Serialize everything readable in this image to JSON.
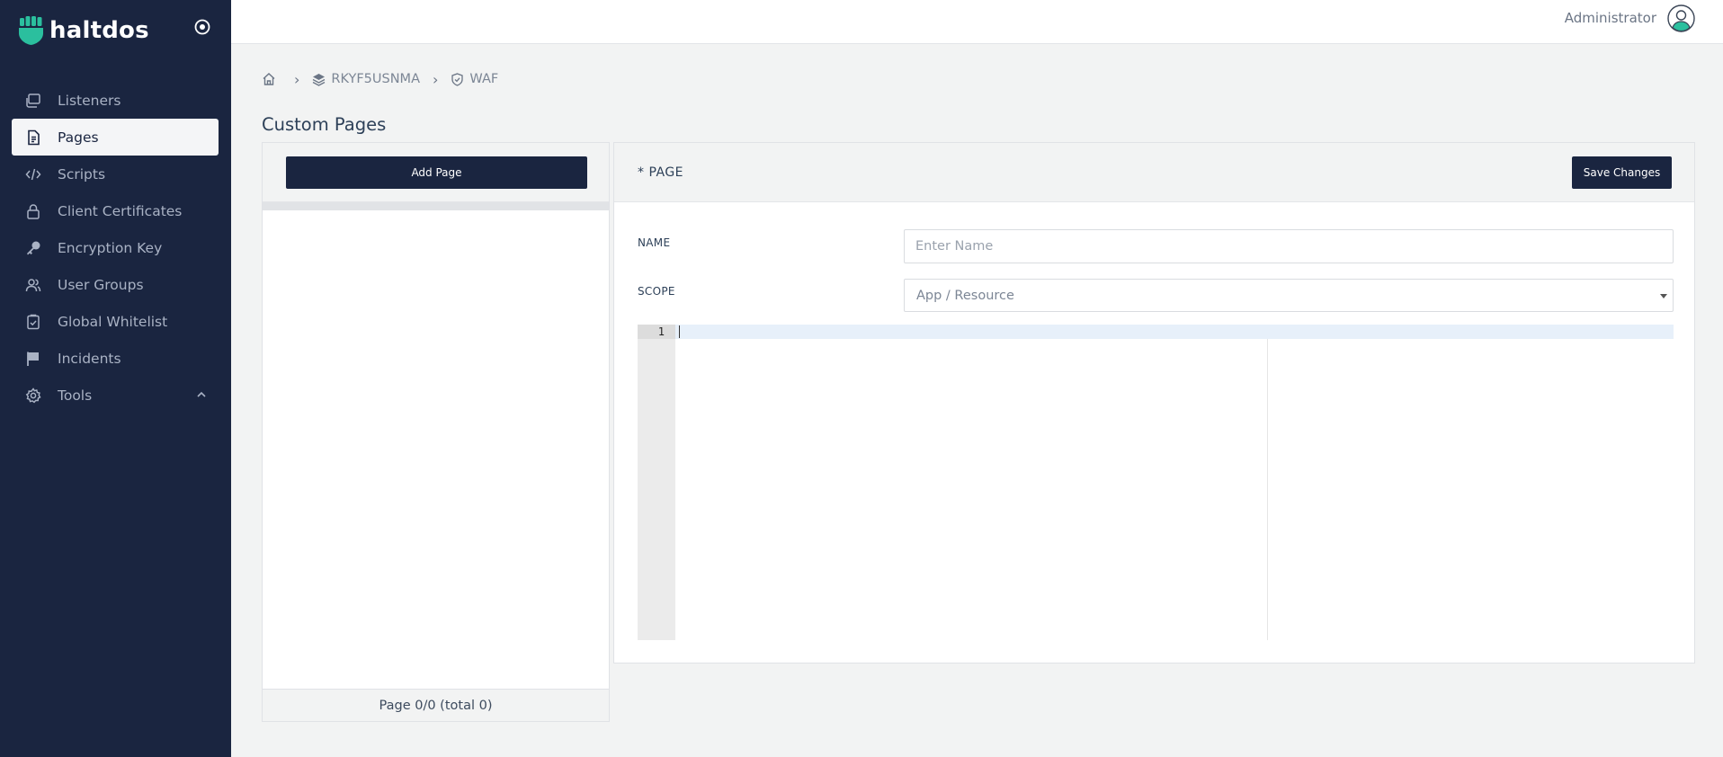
{
  "brand": {
    "name": "haltdos",
    "accent": "#2bbf9e",
    "sidebar_bg": "#1a2540"
  },
  "sidebar": {
    "items": [
      {
        "label": "Listeners",
        "icon": "window-stack-icon"
      },
      {
        "label": "Pages",
        "icon": "document-icon",
        "active": true
      },
      {
        "label": "Scripts",
        "icon": "code-icon"
      },
      {
        "label": "Client Certificates",
        "icon": "lock-icon"
      },
      {
        "label": "Encryption Key",
        "icon": "key-icon"
      },
      {
        "label": "User Groups",
        "icon": "users-icon"
      },
      {
        "label": "Global Whitelist",
        "icon": "clipboard-check-icon"
      },
      {
        "label": "Incidents",
        "icon": "flag-icon"
      },
      {
        "label": "Tools",
        "icon": "gear-icon",
        "expanded": true
      }
    ]
  },
  "header": {
    "user_name": "Administrator"
  },
  "breadcrumb": {
    "items": [
      "RKYF5USNMA",
      "WAF"
    ]
  },
  "page": {
    "title": "Custom Pages"
  },
  "list_panel": {
    "add_label": "Add Page",
    "pagination": "Page 0/0 (total 0)"
  },
  "edit_panel": {
    "title": "* PAGE",
    "save_label": "Save Changes",
    "name_label": "NAME",
    "name_placeholder": "Enter Name",
    "name_value": "",
    "scope_label": "SCOPE",
    "scope_placeholder": "App / Resource",
    "editor": {
      "line_numbers": [
        "1"
      ],
      "content": ""
    }
  }
}
